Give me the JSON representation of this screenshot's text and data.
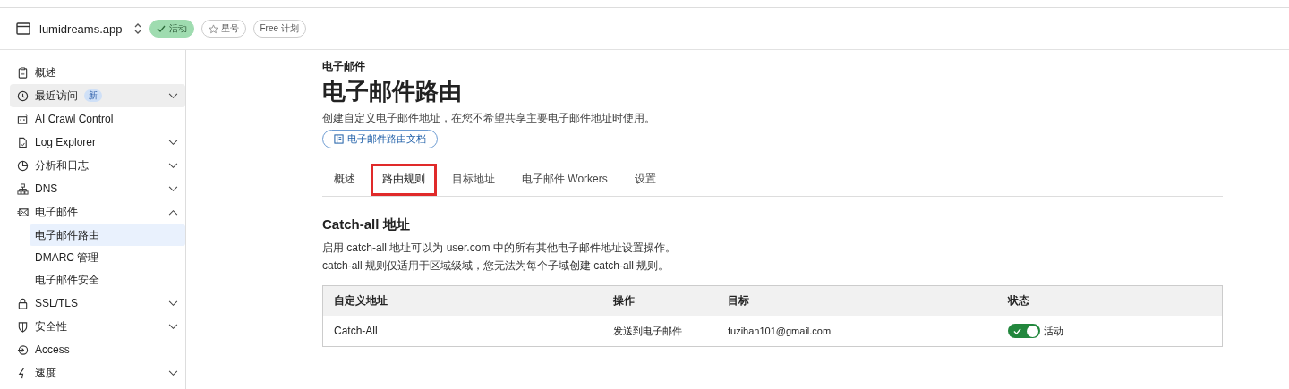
{
  "header": {
    "site": "lumidreams.app",
    "badges": [
      {
        "label": "活动",
        "kind": "status"
      },
      {
        "label": "星号",
        "kind": "star"
      },
      {
        "label": "Free 计划",
        "kind": "plan"
      }
    ]
  },
  "sidebar": {
    "items": [
      {
        "label": "概述",
        "selected": false
      },
      {
        "label": "最近访问",
        "badge": "新",
        "selected": true,
        "expanded": false
      },
      {
        "label": "AI Crawl Control",
        "selected": false
      },
      {
        "label": "Log Explorer",
        "selected": false,
        "expanded": false
      },
      {
        "label": "分析和日志",
        "selected": false,
        "expanded": false
      },
      {
        "label": "DNS",
        "selected": false,
        "expanded": false
      },
      {
        "label": "电子邮件",
        "selected": false,
        "expanded": true,
        "children": [
          {
            "label": "电子邮件路由",
            "selected": true
          },
          {
            "label": "DMARC 管理",
            "selected": false
          },
          {
            "label": "电子邮件安全",
            "selected": false
          }
        ]
      },
      {
        "label": "SSL/TLS",
        "selected": false,
        "expanded": false
      },
      {
        "label": "安全性",
        "selected": false,
        "expanded": false
      },
      {
        "label": "Access",
        "selected": false
      },
      {
        "label": "速度",
        "selected": false,
        "expanded": false
      }
    ]
  },
  "page": {
    "eyebrow": "电子邮件",
    "title": "电子邮件路由",
    "description": "创建自定义电子邮件地址，在您不希望共享主要电子邮件地址时使用。",
    "docs_link": "电子邮件路由文档",
    "tabs": [
      {
        "label": "概述",
        "selected": false
      },
      {
        "label": "路由规则",
        "selected": true
      },
      {
        "label": "目标地址",
        "selected": false
      },
      {
        "label": "电子邮件 Workers",
        "selected": false
      },
      {
        "label": "设置",
        "selected": false
      }
    ],
    "section": {
      "title": "Catch-all 地址",
      "lines": [
        "启用 catch-all 地址可以为 user.com 中的所有其他电子邮件地址设置操作。",
        "catch-all 规则仅适用于区域级域，您无法为每个子域创建 catch-all 规则。"
      ],
      "table": {
        "columns": [
          "自定义地址",
          "操作",
          "目标",
          "状态"
        ],
        "rows": [
          {
            "address": "Catch-All",
            "action": "发送到电子邮件",
            "target": "fuzihan101@gmail.com",
            "on": true,
            "status": "活动"
          }
        ]
      }
    }
  }
}
